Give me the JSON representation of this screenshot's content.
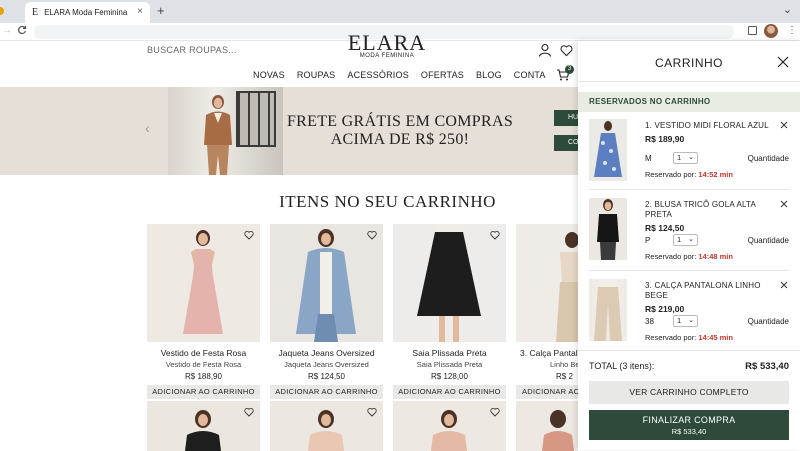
{
  "browser": {
    "tab_title": "ELARA Moda Feminina",
    "tab_favicon": "E",
    "newtab_glyph": "+",
    "close_glyph": "×",
    "minimize_glyph": "⌄",
    "back_glyph": "→",
    "reload_glyph": "C",
    "menu_glyph": "⋮"
  },
  "header": {
    "search_placeholder": "BUSCAR ROUPAS...",
    "logo": "ELARA",
    "logo_sub": "MODA FEMININA",
    "cart_count": "3",
    "nav": [
      "NOVAS",
      "ROUPAS",
      "ACESSÓRIOS",
      "OFERTAS",
      "BLOG",
      "CONTA"
    ]
  },
  "hero": {
    "line1": "FRETE GRÁTIS EM COMPRAS",
    "line2": "ACIMA DE R$ 250!",
    "btn1": "HU",
    "btn2": "COM",
    "prev_glyph": "‹"
  },
  "section_title": "ITENS NO SEU CARRINHO",
  "products": [
    {
      "name": "Vestido de Festa Rosa",
      "sub": "Vestido de Festa Rosa",
      "price": "R$ 188,90",
      "add": "ADICIONAR AO CARRINHO"
    },
    {
      "name": "Jaqueta Jeans Oversized",
      "sub": "Jaqueta Jeans Oversized",
      "price": "R$ 124,50",
      "add": "ADICIONAR AO CARRINHO"
    },
    {
      "name": "Saia Plissada Preta",
      "sub": "Saia Plissada Preta",
      "price": "R$ 128,00",
      "add": "ADICIONAR AO CARRINHO"
    },
    {
      "name": "3. Calça Pantal",
      "sub": "Linho Beg",
      "price": "R$ 2",
      "add": "ADICIONAR AO"
    }
  ],
  "cart": {
    "title": "CARRINHO",
    "reserved_header": "RESERVADOS NO CARRINHO",
    "qty_label": "Quantidade",
    "reserved_label": "Reservado por:",
    "items": [
      {
        "title": "1. VESTIDO MIDI FLORAL AZUL",
        "price": "R$ 189,90",
        "size": "M",
        "qty": "1",
        "timer": "14:52 min"
      },
      {
        "title": "2. BLUSA TRICÔ GOLA ALTA PRETA",
        "price": "R$ 124,50",
        "size": "P",
        "qty": "1",
        "timer": "14:48 min"
      },
      {
        "title": "3. CALÇA PANTALONA LINHO BEGE",
        "price": "R$ 219,00",
        "size": "38",
        "qty": "1",
        "timer": "14:45 min"
      }
    ],
    "total_label": "TOTAL (3 itens):",
    "total_value": "R$ 533,40",
    "view_cart": "VER CARRINHO COMPLETO",
    "checkout": "FINALIZAR COMPRA",
    "checkout_total": "R$ 533,40"
  },
  "colors": {
    "accent": "#2d4a3a",
    "reserved_bg": "#e9ece3",
    "timer": "#c0392b",
    "hero_bg": "#e5dfd7"
  }
}
